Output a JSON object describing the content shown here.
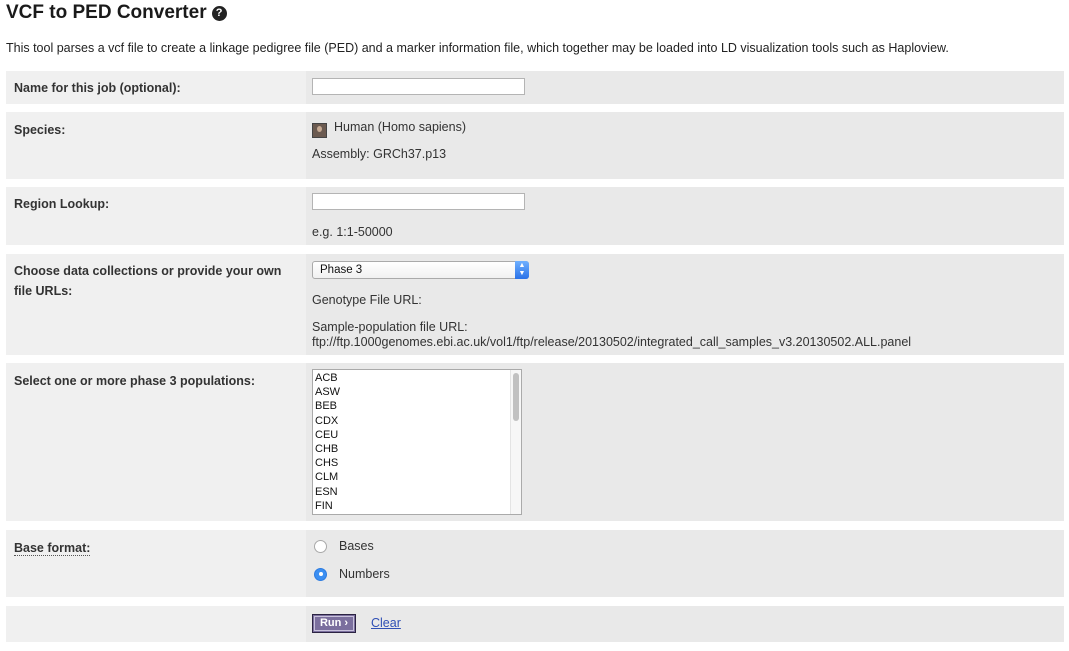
{
  "page": {
    "title": "VCF to PED Converter",
    "help_icon": "?",
    "description": "This tool parses a vcf file to create a linkage pedigree file (PED) and a marker information file, which together may be loaded into LD visualization tools such as Haploview."
  },
  "form": {
    "job_name": {
      "label": "Name for this job (optional):",
      "value": ""
    },
    "species": {
      "label": "Species:",
      "icon": "human-species-icon",
      "name": "Human (Homo sapiens)",
      "assembly": "Assembly: GRCh37.p13"
    },
    "region": {
      "label": "Region Lookup:",
      "value": "",
      "example": "e.g. 1:1-50000"
    },
    "collections": {
      "label": "Choose data collections or provide your own file URLs:",
      "selected": "Phase 3",
      "genotype_label": "Genotype File URL:",
      "sample_label": "Sample-population file URL:",
      "sample_url": "ftp://ftp.1000genomes.ebi.ac.uk/vol1/ftp/release/20130502/integrated_call_samples_v3.20130502.ALL.panel"
    },
    "populations": {
      "label": "Select one or more phase 3 populations:",
      "options": [
        "ACB",
        "ASW",
        "BEB",
        "CDX",
        "CEU",
        "CHB",
        "CHS",
        "CLM",
        "ESN",
        "FIN"
      ]
    },
    "base_format": {
      "label": "Base format:",
      "options": [
        {
          "label": "Bases",
          "checked": false
        },
        {
          "label": "Numbers",
          "checked": true
        }
      ]
    },
    "actions": {
      "run_label": "Run ›",
      "clear_label": "Clear"
    }
  }
}
